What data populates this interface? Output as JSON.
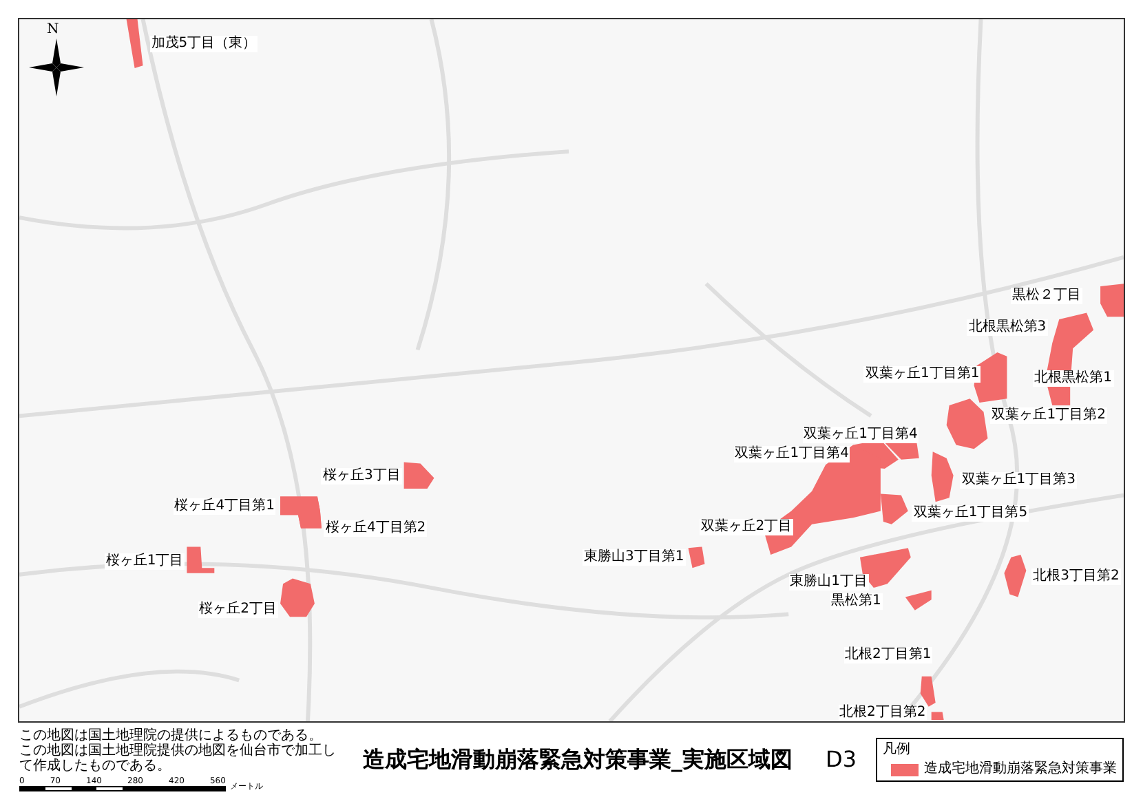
{
  "map": {
    "north_label": "N",
    "zones": [
      {
        "label": "加茂5丁目（東）"
      },
      {
        "label": "黒松２丁目"
      },
      {
        "label": "北根黒松第3"
      },
      {
        "label": "双葉ヶ丘1丁目第1"
      },
      {
        "label": "北根黒松第1"
      },
      {
        "label": "双葉ヶ丘1丁目第2"
      },
      {
        "label": "双葉ヶ丘1丁目第4"
      },
      {
        "label": "双葉ヶ丘1丁目第4"
      },
      {
        "label": "双葉ヶ丘1丁目第3"
      },
      {
        "label": "双葉ヶ丘2丁目"
      },
      {
        "label": "双葉ヶ丘1丁目第5"
      },
      {
        "label": "東勝山3丁目第1"
      },
      {
        "label": "東勝山1丁目"
      },
      {
        "label": "北根3丁目第2"
      },
      {
        "label": "黒松第1"
      },
      {
        "label": "北根2丁目第1"
      },
      {
        "label": "北根2丁目第2"
      },
      {
        "label": "桜ヶ丘3丁目"
      },
      {
        "label": "桜ヶ丘4丁目第1"
      },
      {
        "label": "桜ヶ丘4丁目第2"
      },
      {
        "label": "桜ヶ丘1丁目"
      },
      {
        "label": "桜ヶ丘2丁目"
      }
    ]
  },
  "footer": {
    "notes": [
      "この地図は国土地理院の提供によるものである。",
      "この地図は国土地理院提供の地図を仙台市で加工して作成したものである。"
    ],
    "scale": {
      "ticks": [
        "0",
        "70",
        "140",
        "280",
        "420",
        "560"
      ],
      "unit": "メートル"
    },
    "title": "造成宅地滑動崩落緊急対策事業_実施区域図",
    "sheet": "D3",
    "legend": {
      "title": "凡例",
      "items": [
        {
          "label": "造成宅地滑動崩落緊急対策事業",
          "color": "#f26b6b"
        }
      ]
    }
  }
}
